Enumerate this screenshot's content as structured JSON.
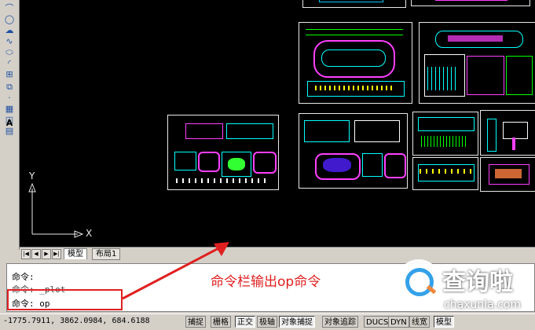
{
  "left_toolbar": {
    "icons": [
      "arc-icon",
      "circle-icon",
      "revision-cloud-icon",
      "spline-icon",
      "ellipse-icon",
      "ellipse-arc-icon",
      "insert-block-icon",
      "make-block-icon",
      "point-icon",
      "hatch-icon",
      "region-icon",
      "table-icon",
      "text-icon"
    ],
    "text_tool_label": "A"
  },
  "drawing_area": {
    "background": "#000000",
    "ucs": {
      "x_label": "X",
      "y_label": "Y"
    }
  },
  "layout_tabs": {
    "nav_buttons": [
      "|◀",
      "◀",
      "▶",
      "▶|"
    ],
    "tabs": [
      {
        "label": "模型",
        "active": true
      },
      {
        "label": "布局1",
        "active": false
      }
    ]
  },
  "command_window": {
    "lines": [
      "命令:",
      "命令: _plot",
      "命令: op"
    ]
  },
  "annotation": {
    "text": "命令栏输出op命令",
    "color": "#e02020"
  },
  "status_bar": {
    "coordinates": "-1775.7911, 3862.0984, 684.6188",
    "toggles": [
      {
        "label": "捕捉",
        "on": false
      },
      {
        "label": "栅格",
        "on": false
      },
      {
        "label": "正交",
        "on": true
      },
      {
        "label": "极轴",
        "on": false
      },
      {
        "label": "对象捕捉",
        "on": true
      },
      {
        "label": "对象追踪",
        "on": false
      },
      {
        "label": "DUCS",
        "on": false
      },
      {
        "label": "DYN",
        "on": false
      },
      {
        "label": "线宽",
        "on": false
      },
      {
        "label": "模型",
        "on": true
      }
    ]
  },
  "watermark": {
    "brand": "查询啦",
    "domain": "chaxunla.com"
  }
}
